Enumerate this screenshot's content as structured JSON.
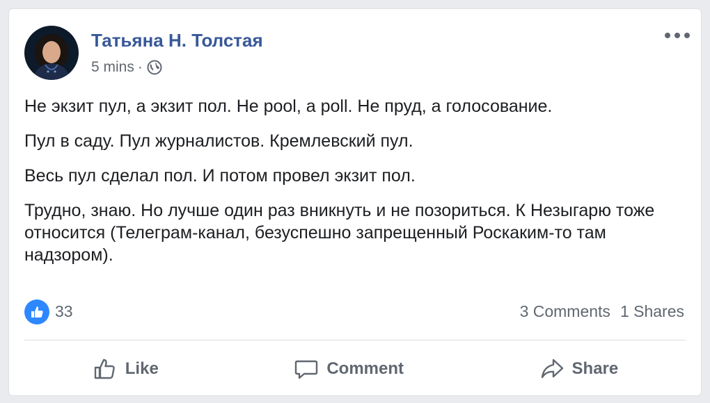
{
  "post": {
    "author": "Татьяна Н. Толстая",
    "time": "5 mins",
    "separator": "·",
    "privacy_icon": "globe-icon",
    "paragraphs": [
      "Не экзит пул, а экзит пол. Не pool, а poll. Не пруд, а голосование.",
      "Пул в саду. Пул журналистов. Кремлевский пул.",
      "Весь пул сделал пол. И потом провел экзит пол.",
      "Трудно, знаю. Но лучше один раз вникнуть и не позориться. К Незыгарю тоже относится (Телеграм-канал, безуспешно запрещенный Роскаким-то там надзором)."
    ]
  },
  "reactions": {
    "like_count": "33",
    "comments": "3 Comments",
    "shares": "1 Shares"
  },
  "actions": {
    "like": "Like",
    "comment": "Comment",
    "share": "Share"
  },
  "colors": {
    "author": "#385898",
    "like_badge": "#2d88ff",
    "muted": "#606770"
  }
}
